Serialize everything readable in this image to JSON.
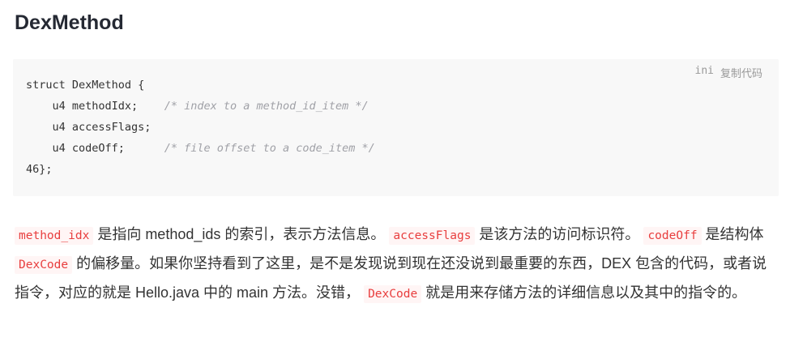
{
  "heading": "DexMethod",
  "code": {
    "lang": "ini",
    "copy_label": "复制代码",
    "line1": "struct DexMethod {",
    "line2_code": "    u4 methodIdx;",
    "line2_comment": "/* index to a method_id_item */",
    "line3_code": "    u4 accessFlags;",
    "line4_code": "    u4 codeOff;",
    "line4_comment": "/* file offset to a code_item */",
    "line5": "46};"
  },
  "paragraph": {
    "code1": "method_idx",
    "text1": " 是指向 method_ids 的索引，表示方法信息。",
    "code2": "accessFlags",
    "text2": " 是该方法的访问标识符。",
    "code3": "codeOff",
    "text3": " 是结构体 ",
    "code4": "DexCode",
    "text4": " 的偏移量。如果你坚持看到了这里，是不是发现说到现在还没说到最重要的东西，DEX 包含的代码，或者说指令，对应的就是 Hello.java 中的 main 方法。没错，",
    "code5": "DexCode",
    "text5": " 就是用来存储方法的详细信息以及其中的指令的。"
  }
}
